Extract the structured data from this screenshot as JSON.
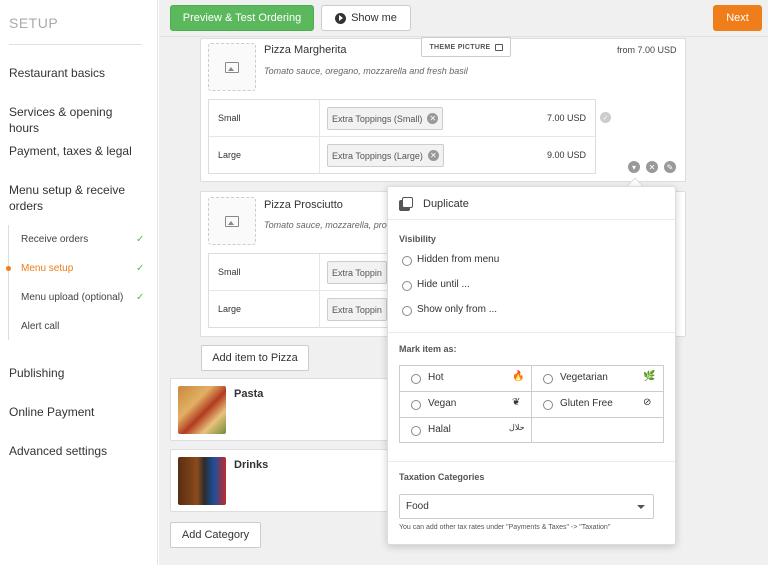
{
  "sidebar": {
    "title": "SETUP",
    "items": [
      {
        "label": "Restaurant basics"
      },
      {
        "label": "Services & opening hours"
      },
      {
        "label": "Payment, taxes & legal"
      },
      {
        "label": "Menu setup & receive orders"
      },
      {
        "label": "Publishing"
      },
      {
        "label": "Online Payment"
      },
      {
        "label": "Advanced settings"
      }
    ],
    "subitems": [
      {
        "label": "Receive orders",
        "checked": true
      },
      {
        "label": "Menu setup",
        "checked": true,
        "active": true
      },
      {
        "label": "Menu upload (optional)",
        "checked": true
      },
      {
        "label": "Alert call",
        "checked": false
      }
    ],
    "check_mark": "✓"
  },
  "toolbar": {
    "preview_label": "Preview & Test Ordering",
    "show_me_label": "Show me",
    "next_label": "Next"
  },
  "items": [
    {
      "name": "Pizza Margherita",
      "description": "Tomato sauce, oregano, mozzarella and fresh basil",
      "price": "from 7.00 USD",
      "theme_picture_label": "THEME PICTURE",
      "sizes": [
        {
          "label": "Small",
          "tag": "Extra Toppings (Small)",
          "price": "7.00 USD"
        },
        {
          "label": "Large",
          "tag": "Extra Toppings (Large)",
          "price": "9.00 USD"
        }
      ]
    },
    {
      "name": "Pizza Prosciutto",
      "description": "Tomato sauce, mozzarella, pro",
      "sizes": [
        {
          "label": "Small",
          "tag": "Extra Toppin"
        },
        {
          "label": "Large",
          "tag": "Extra Toppin"
        }
      ]
    }
  ],
  "add_item_label": "Add item to Pizza",
  "categories": [
    {
      "name": "Pasta"
    },
    {
      "name": "Drinks"
    }
  ],
  "add_category_label": "Add Category",
  "popover": {
    "duplicate_label": "Duplicate",
    "visibility_heading": "Visibility",
    "visibility_options": [
      "Hidden from menu",
      "Hide until ...",
      "Show only from ..."
    ],
    "mark_heading": "Mark item as:",
    "marks": [
      {
        "label": "Hot",
        "icon": "🔥"
      },
      {
        "label": "Vegetarian",
        "icon": "🌿"
      },
      {
        "label": "Vegan",
        "icon": "❦"
      },
      {
        "label": "Gluten Free",
        "icon": "⊘"
      },
      {
        "label": "Halal",
        "icon": "حلال"
      }
    ],
    "tax_heading": "Taxation Categories",
    "tax_selected": "Food",
    "tax_hint": "You can add other tax rates under \"Payments & Taxes\" -> \"Taxation\""
  },
  "colors": {
    "accent_orange": "#ee7d1a",
    "green": "#5cb85c"
  }
}
